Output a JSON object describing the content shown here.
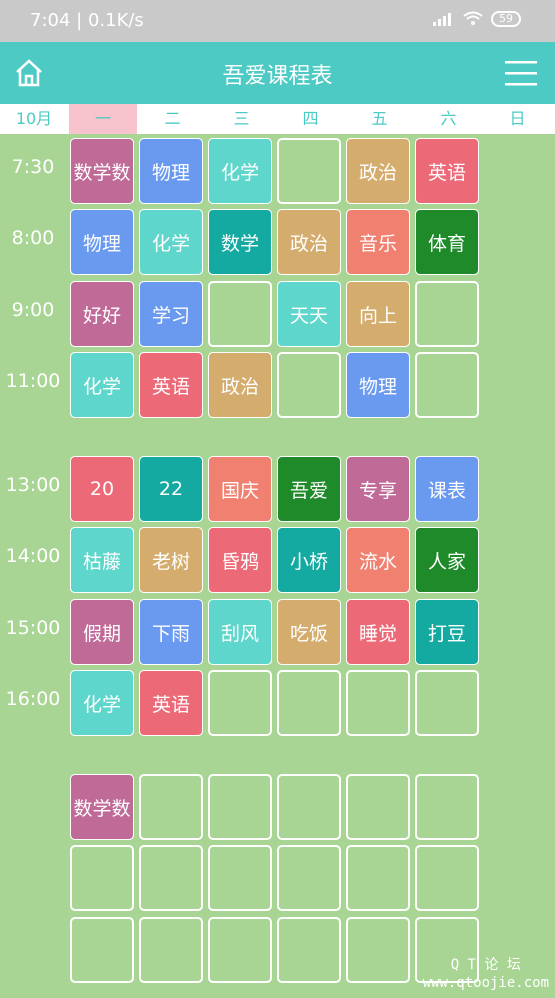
{
  "status": {
    "time": "7:04",
    "speed": "0.1K/s",
    "battery": "59"
  },
  "app": {
    "title": "吾爱课程表"
  },
  "week": {
    "month": "10月",
    "days": [
      "一",
      "二",
      "三",
      "四",
      "五",
      "六",
      "日"
    ],
    "today_index": 0
  },
  "times": [
    "7:30",
    "8:00",
    "9:00",
    "11:00",
    "13:00",
    "14:00",
    "15:00",
    "16:00"
  ],
  "colors": {
    "pink": "#c06a98",
    "blue": "#6a9af0",
    "aqua": "#5fd6cc",
    "teal": "#14aaa2",
    "tan": "#d4ad6e",
    "red": "#ec6a78",
    "salmon": "#f08070",
    "green": "#1f8a2a",
    "appbar": "#4ecac4",
    "background": "#a9d594"
  },
  "courses": [
    {
      "day": 0,
      "row": 0,
      "name": "数学数",
      "color": "pink"
    },
    {
      "day": 1,
      "row": 0,
      "name": "物理",
      "color": "blue"
    },
    {
      "day": 2,
      "row": 0,
      "name": "化学",
      "color": "aqua"
    },
    {
      "day": 4,
      "row": 0,
      "name": "政治",
      "color": "tan"
    },
    {
      "day": 5,
      "row": 0,
      "name": "英语",
      "color": "red"
    },
    {
      "day": 0,
      "row": 1,
      "name": "物理",
      "color": "blue"
    },
    {
      "day": 1,
      "row": 1,
      "name": "化学",
      "color": "aqua"
    },
    {
      "day": 2,
      "row": 1,
      "name": "数学",
      "color": "teal"
    },
    {
      "day": 3,
      "row": 1,
      "name": "政治",
      "color": "tan"
    },
    {
      "day": 4,
      "row": 1,
      "name": "音乐",
      "color": "salmon"
    },
    {
      "day": 5,
      "row": 1,
      "name": "体育",
      "color": "green"
    },
    {
      "day": 0,
      "row": 2,
      "name": "好好",
      "color": "pink"
    },
    {
      "day": 1,
      "row": 2,
      "name": "学习",
      "color": "blue"
    },
    {
      "day": 3,
      "row": 2,
      "name": "天天",
      "color": "aqua"
    },
    {
      "day": 4,
      "row": 2,
      "name": "向上",
      "color": "tan"
    },
    {
      "day": 0,
      "row": 3,
      "name": "化学",
      "color": "aqua"
    },
    {
      "day": 1,
      "row": 3,
      "name": "英语",
      "color": "red"
    },
    {
      "day": 2,
      "row": 3,
      "name": "政治",
      "color": "tan"
    },
    {
      "day": 4,
      "row": 3,
      "name": "物理",
      "color": "blue"
    },
    {
      "day": 0,
      "row": 4,
      "name": "20",
      "color": "red"
    },
    {
      "day": 1,
      "row": 4,
      "name": "22",
      "color": "teal"
    },
    {
      "day": 2,
      "row": 4,
      "name": "国庆",
      "color": "salmon"
    },
    {
      "day": 3,
      "row": 4,
      "name": "吾爱",
      "color": "green"
    },
    {
      "day": 4,
      "row": 4,
      "name": "专享",
      "color": "pink"
    },
    {
      "day": 5,
      "row": 4,
      "name": "课表",
      "color": "blue"
    },
    {
      "day": 0,
      "row": 5,
      "name": "枯藤",
      "color": "aqua"
    },
    {
      "day": 1,
      "row": 5,
      "name": "老树",
      "color": "tan"
    },
    {
      "day": 2,
      "row": 5,
      "name": "昏鸦",
      "color": "red"
    },
    {
      "day": 3,
      "row": 5,
      "name": "小桥",
      "color": "teal"
    },
    {
      "day": 4,
      "row": 5,
      "name": "流水",
      "color": "salmon"
    },
    {
      "day": 5,
      "row": 5,
      "name": "人家",
      "color": "green"
    },
    {
      "day": 0,
      "row": 6,
      "name": "假期",
      "color": "pink"
    },
    {
      "day": 1,
      "row": 6,
      "name": "下雨",
      "color": "blue"
    },
    {
      "day": 2,
      "row": 6,
      "name": "刮风",
      "color": "aqua"
    },
    {
      "day": 3,
      "row": 6,
      "name": "吃饭",
      "color": "tan"
    },
    {
      "day": 4,
      "row": 6,
      "name": "睡觉",
      "color": "red"
    },
    {
      "day": 5,
      "row": 6,
      "name": "打豆",
      "color": "teal"
    },
    {
      "day": 0,
      "row": 7,
      "name": "化学",
      "color": "aqua"
    },
    {
      "day": 1,
      "row": 7,
      "name": "英语",
      "color": "red"
    },
    {
      "day": 0,
      "row": 8,
      "name": "数学数",
      "color": "pink"
    }
  ],
  "watermark": {
    "line1": "Q T 论 坛",
    "line2": "www.qtoojie.com"
  }
}
